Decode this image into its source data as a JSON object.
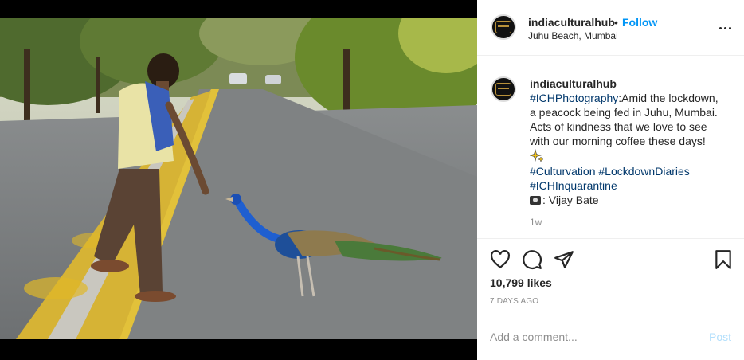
{
  "post": {
    "image_alt": "Man feeding a peacock on a road",
    "username": "indiaculturalhub",
    "separator": "•",
    "follow_label": "Follow",
    "location": "Juhu Beach, Mumbai",
    "more_icon": "more-options-icon"
  },
  "caption": {
    "username": "indiaculturalhub",
    "hashtag_main": "#ICHPhotography",
    "line1_rest": ":Amid the lockdown,",
    "line2": "a peacock being fed in Juhu, Mumbai.",
    "line3": "Acts of kindness that we love to see",
    "line4": "with our morning coffee these days!",
    "emoji": "sparkles-icon",
    "hashtag_culturvation": "#Culturvation",
    "hashtag_lockdown": "#LockdownDiaries",
    "hashtag_inquarantine": "#ICHInquarantine",
    "credit": ": Vijay Bate",
    "time": "1w"
  },
  "actions": {
    "icons": [
      "heart-icon",
      "comment-icon",
      "share-icon",
      "bookmark-icon"
    ],
    "likes": "10,799 likes",
    "posted_ago": "7 DAYS AGO"
  },
  "comment": {
    "placeholder": "Add a comment...",
    "post_label": "Post"
  },
  "colors": {
    "accent": "#0095f6",
    "hashtag": "#00376b",
    "muted": "#8e8e8e",
    "post_disabled": "#b2dffc"
  }
}
